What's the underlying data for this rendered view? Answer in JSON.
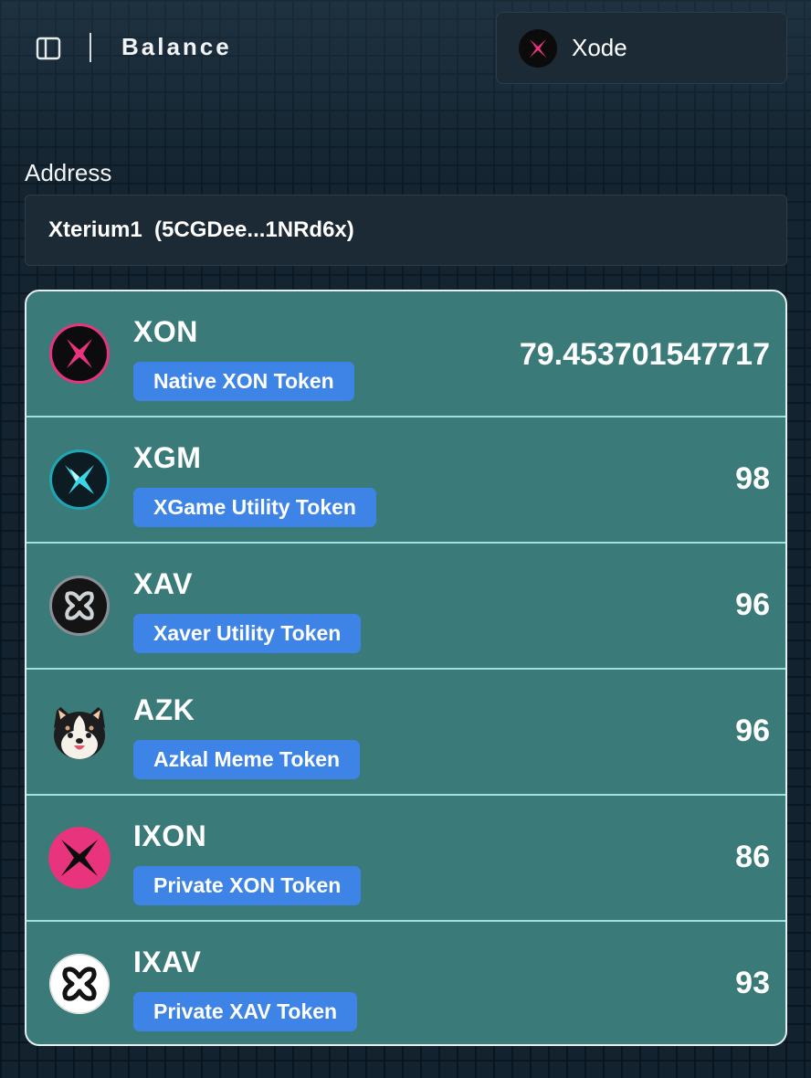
{
  "header": {
    "title": "Balance",
    "sidebar_toggle_icon": "sidebar-panel-icon",
    "network": {
      "name": "Xode",
      "logo_icon": "xode-x-logo-icon"
    }
  },
  "address": {
    "label": "Address",
    "value": "Xterium1  (5CGDee...1NRd6x)"
  },
  "colors": {
    "card_bg": "#3a7b7a",
    "badge_bg": "#3e84e6",
    "xon_pink": "#e8337d",
    "xgm_cyan": "#38d6e6",
    "divider": "#9ee3dc"
  },
  "tokens": [
    {
      "symbol": "XON",
      "name": "Native XON Token",
      "balance": "79.453701547717",
      "icon": "xon-logo-icon"
    },
    {
      "symbol": "XGM",
      "name": "XGame Utility Token",
      "balance": "98",
      "icon": "xgm-logo-icon"
    },
    {
      "symbol": "XAV",
      "name": "Xaver Utility Token",
      "balance": "96",
      "icon": "xav-logo-icon"
    },
    {
      "symbol": "AZK",
      "name": "Azkal Meme Token",
      "balance": "96",
      "icon": "azkal-dog-icon"
    },
    {
      "symbol": "IXON",
      "name": "Private XON Token",
      "balance": "86",
      "icon": "ixon-logo-icon"
    },
    {
      "symbol": "IXAV",
      "name": "Private XAV Token",
      "balance": "93",
      "icon": "ixav-logo-icon"
    }
  ]
}
